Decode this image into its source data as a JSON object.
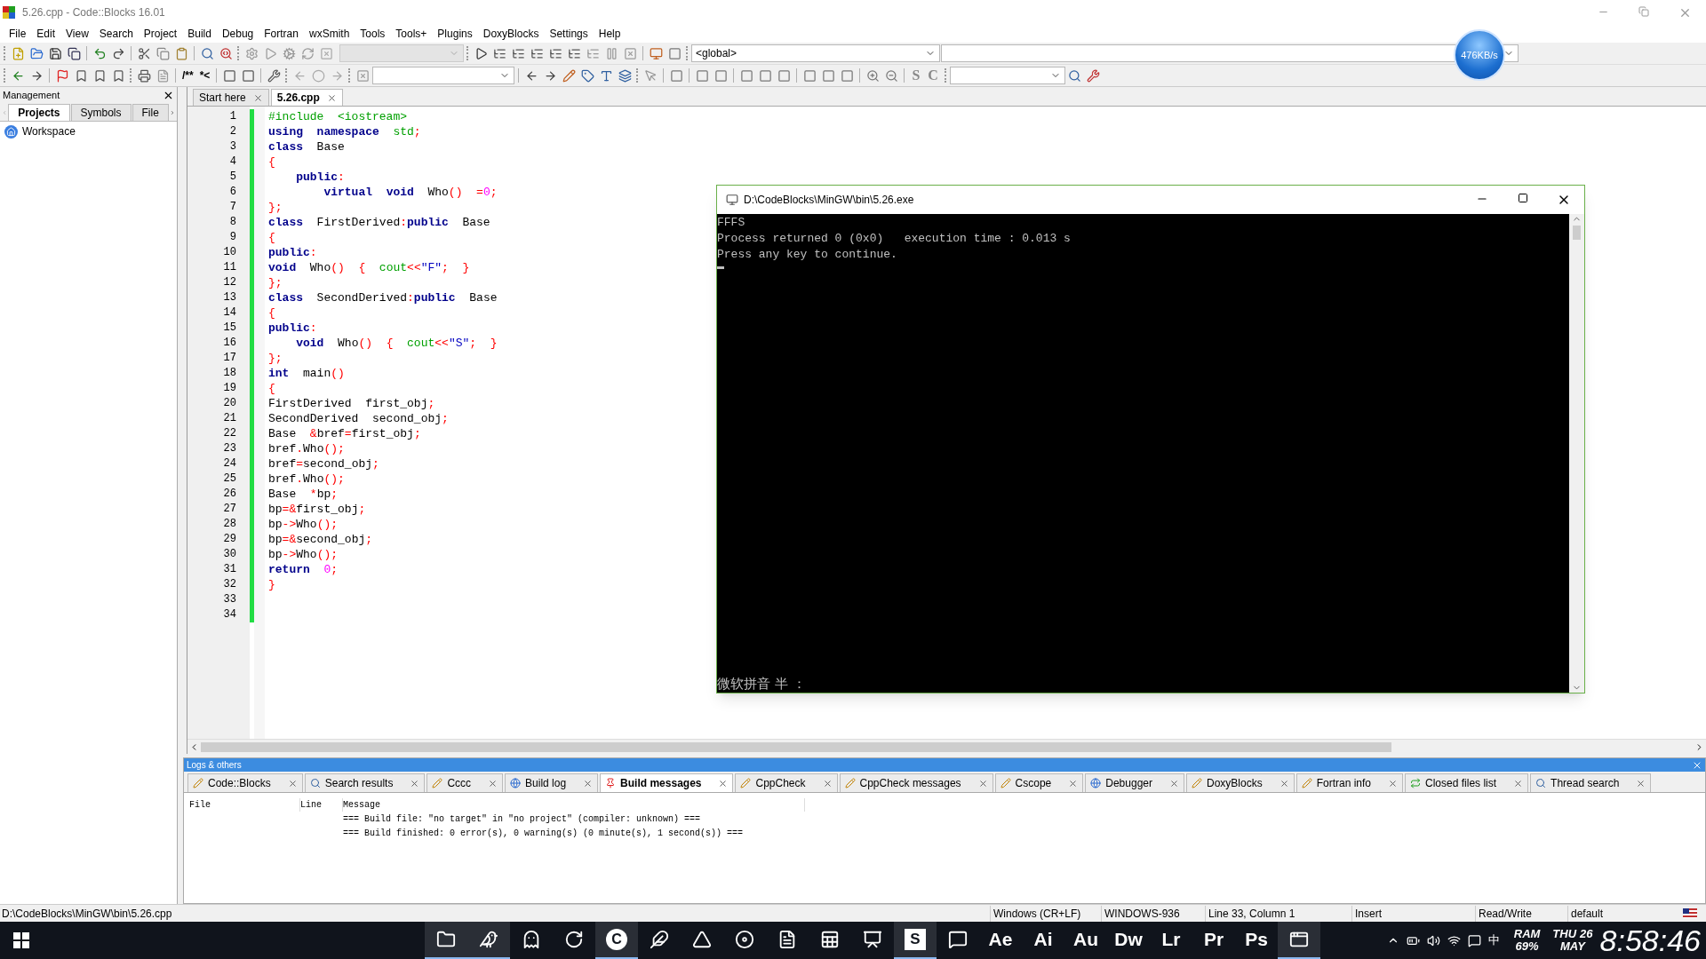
{
  "window": {
    "title": "5.26.cpp - Code::Blocks 16.01"
  },
  "menu": [
    "File",
    "Edit",
    "View",
    "Search",
    "Project",
    "Build",
    "Debug",
    "Fortran",
    "wxSmith",
    "Tools",
    "Tools+",
    "Plugins",
    "DoxyBlocks",
    "Settings",
    "Help"
  ],
  "toolbar": {
    "scope": "<global>",
    "comment_buttons": [
      "/**",
      "*<"
    ],
    "text_buttons": [
      "S",
      "C"
    ]
  },
  "net_speed": "476KB/s",
  "management": {
    "title": "Management",
    "tabs": [
      {
        "label": "Projects",
        "selected": true
      },
      {
        "label": "Symbols",
        "selected": false
      },
      {
        "label": "File",
        "selected": false
      }
    ],
    "tree": [
      {
        "label": "Workspace"
      }
    ]
  },
  "editor": {
    "tabs": [
      {
        "label": "Start here",
        "selected": false
      },
      {
        "label": "5.26.cpp",
        "selected": true
      }
    ],
    "lines": [
      {
        "number": "1",
        "tokens": [
          {
            "text": "#include  <iostream>",
            "kind": "pp"
          }
        ]
      },
      {
        "number": "2",
        "tokens": [
          {
            "text": "using",
            "kind": "kw"
          },
          {
            "text": "  namespace",
            "kind": "kw"
          },
          {
            "text": "  std",
            "kind": "lib"
          },
          {
            "text": ";",
            "kind": "op"
          }
        ]
      },
      {
        "number": "3",
        "tokens": [
          {
            "text": "class",
            "kind": "kw"
          },
          {
            "text": "  Base",
            "kind": "plain"
          }
        ]
      },
      {
        "number": "4",
        "tokens": [
          {
            "text": "{",
            "kind": "op"
          }
        ]
      },
      {
        "number": "5",
        "tokens": [
          {
            "text": "    public",
            "kind": "kw"
          },
          {
            "text": ":",
            "kind": "op"
          }
        ]
      },
      {
        "number": "6",
        "tokens": [
          {
            "text": "        virtual",
            "kind": "kw"
          },
          {
            "text": "  void",
            "kind": "kw"
          },
          {
            "text": "  Who",
            "kind": "plain"
          },
          {
            "text": "()",
            "kind": "op"
          },
          {
            "text": "  =",
            "kind": "op"
          },
          {
            "text": "0",
            "kind": "num"
          },
          {
            "text": ";",
            "kind": "op"
          }
        ]
      },
      {
        "number": "7",
        "tokens": [
          {
            "text": "};",
            "kind": "op"
          }
        ]
      },
      {
        "number": "8",
        "tokens": [
          {
            "text": "class",
            "kind": "kw"
          },
          {
            "text": "  FirstDerived",
            "kind": "plain"
          },
          {
            "text": ":",
            "kind": "op"
          },
          {
            "text": "public",
            "kind": "kw"
          },
          {
            "text": "  Base",
            "kind": "plain"
          }
        ]
      },
      {
        "number": "9",
        "tokens": [
          {
            "text": "{",
            "kind": "op"
          }
        ]
      },
      {
        "number": "10",
        "tokens": [
          {
            "text": "public",
            "kind": "kw"
          },
          {
            "text": ":",
            "kind": "op"
          }
        ]
      },
      {
        "number": "11",
        "tokens": [
          {
            "text": "void",
            "kind": "kw"
          },
          {
            "text": "  Who",
            "kind": "plain"
          },
          {
            "text": "()",
            "kind": "op"
          },
          {
            "text": "  {  ",
            "kind": "op"
          },
          {
            "text": "cout",
            "kind": "lib"
          },
          {
            "text": "<<",
            "kind": "op"
          },
          {
            "text": "\"F\"",
            "kind": "str"
          },
          {
            "text": ";  }",
            "kind": "op"
          }
        ]
      },
      {
        "number": "12",
        "tokens": [
          {
            "text": "};",
            "kind": "op"
          }
        ]
      },
      {
        "number": "13",
        "tokens": [
          {
            "text": "class",
            "kind": "kw"
          },
          {
            "text": "  SecondDerived",
            "kind": "plain"
          },
          {
            "text": ":",
            "kind": "op"
          },
          {
            "text": "public",
            "kind": "kw"
          },
          {
            "text": "  Base",
            "kind": "plain"
          }
        ]
      },
      {
        "number": "14",
        "tokens": [
          {
            "text": "{",
            "kind": "op"
          }
        ]
      },
      {
        "number": "15",
        "tokens": [
          {
            "text": "public",
            "kind": "kw"
          },
          {
            "text": ":",
            "kind": "op"
          }
        ]
      },
      {
        "number": "16",
        "tokens": [
          {
            "text": "    void",
            "kind": "kw"
          },
          {
            "text": "  Who",
            "kind": "plain"
          },
          {
            "text": "()",
            "kind": "op"
          },
          {
            "text": "  {  ",
            "kind": "op"
          },
          {
            "text": "cout",
            "kind": "lib"
          },
          {
            "text": "<<",
            "kind": "op"
          },
          {
            "text": "\"S\"",
            "kind": "str"
          },
          {
            "text": ";  }",
            "kind": "op"
          }
        ]
      },
      {
        "number": "17",
        "tokens": [
          {
            "text": "};",
            "kind": "op"
          }
        ]
      },
      {
        "number": "18",
        "tokens": [
          {
            "text": "int",
            "kind": "kw"
          },
          {
            "text": "  main",
            "kind": "plain"
          },
          {
            "text": "()",
            "kind": "op"
          }
        ]
      },
      {
        "number": "19",
        "tokens": [
          {
            "text": "{",
            "kind": "op"
          }
        ]
      },
      {
        "number": "20",
        "tokens": [
          {
            "text": "FirstDerived  first_obj",
            "kind": "plain"
          },
          {
            "text": ";",
            "kind": "op"
          }
        ]
      },
      {
        "number": "21",
        "tokens": [
          {
            "text": "SecondDerived  second_obj",
            "kind": "plain"
          },
          {
            "text": ";",
            "kind": "op"
          }
        ]
      },
      {
        "number": "22",
        "tokens": [
          {
            "text": "Base  ",
            "kind": "plain"
          },
          {
            "text": "&",
            "kind": "op"
          },
          {
            "text": "bref",
            "kind": "plain"
          },
          {
            "text": "=",
            "kind": "op"
          },
          {
            "text": "first_obj",
            "kind": "plain"
          },
          {
            "text": ";",
            "kind": "op"
          }
        ]
      },
      {
        "number": "23",
        "tokens": [
          {
            "text": "bref",
            "kind": "plain"
          },
          {
            "text": ".",
            "kind": "op"
          },
          {
            "text": "Who",
            "kind": "plain"
          },
          {
            "text": "();",
            "kind": "op"
          }
        ]
      },
      {
        "number": "24",
        "tokens": [
          {
            "text": "bref",
            "kind": "plain"
          },
          {
            "text": "=",
            "kind": "op"
          },
          {
            "text": "second_obj",
            "kind": "plain"
          },
          {
            "text": ";",
            "kind": "op"
          }
        ]
      },
      {
        "number": "25",
        "tokens": [
          {
            "text": "bref",
            "kind": "plain"
          },
          {
            "text": ".",
            "kind": "op"
          },
          {
            "text": "Who",
            "kind": "plain"
          },
          {
            "text": "();",
            "kind": "op"
          }
        ]
      },
      {
        "number": "26",
        "tokens": [
          {
            "text": "Base  ",
            "kind": "plain"
          },
          {
            "text": "*",
            "kind": "op"
          },
          {
            "text": "bp",
            "kind": "plain"
          },
          {
            "text": ";",
            "kind": "op"
          }
        ]
      },
      {
        "number": "27",
        "tokens": [
          {
            "text": "bp",
            "kind": "plain"
          },
          {
            "text": "=&",
            "kind": "op"
          },
          {
            "text": "first_obj",
            "kind": "plain"
          },
          {
            "text": ";",
            "kind": "op"
          }
        ]
      },
      {
        "number": "28",
        "tokens": [
          {
            "text": "bp",
            "kind": "plain"
          },
          {
            "text": "->",
            "kind": "op"
          },
          {
            "text": "Who",
            "kind": "plain"
          },
          {
            "text": "();",
            "kind": "op"
          }
        ]
      },
      {
        "number": "29",
        "tokens": [
          {
            "text": "bp",
            "kind": "plain"
          },
          {
            "text": "=&",
            "kind": "op"
          },
          {
            "text": "second_obj",
            "kind": "plain"
          },
          {
            "text": ";",
            "kind": "op"
          }
        ]
      },
      {
        "number": "30",
        "tokens": [
          {
            "text": "bp",
            "kind": "plain"
          },
          {
            "text": "->",
            "kind": "op"
          },
          {
            "text": "Who",
            "kind": "plain"
          },
          {
            "text": "();",
            "kind": "op"
          }
        ]
      },
      {
        "number": "31",
        "tokens": [
          {
            "text": "return",
            "kind": "kw"
          },
          {
            "text": "  0",
            "kind": "num"
          },
          {
            "text": ";",
            "kind": "op"
          }
        ]
      },
      {
        "number": "32",
        "tokens": [
          {
            "text": "}",
            "kind": "op"
          }
        ]
      },
      {
        "number": "33"
      },
      {
        "number": "34"
      }
    ]
  },
  "console": {
    "title": "D:\\CodeBlocks\\MinGW\\bin\\5.26.exe",
    "lines": [
      "FFFS",
      "Process returned 0 (0x0)   execution time : 0.013 s",
      "Press any key to continue."
    ],
    "ime_status": "微软拼音 半 ："
  },
  "logs": {
    "title": "Logs & others",
    "tabs": [
      {
        "label": "Code::Blocks",
        "selected": false
      },
      {
        "label": "Search results",
        "selected": false
      },
      {
        "label": "Cccc",
        "selected": false
      },
      {
        "label": "Build log",
        "selected": false
      },
      {
        "label": "Build messages",
        "selected": true
      },
      {
        "label": "CppCheck",
        "selected": false
      },
      {
        "label": "CppCheck messages",
        "selected": false
      },
      {
        "label": "Cscope",
        "selected": false
      },
      {
        "label": "Debugger",
        "selected": false
      },
      {
        "label": "DoxyBlocks",
        "selected": false
      },
      {
        "label": "Fortran info",
        "selected": false
      },
      {
        "label": "Closed files list",
        "selected": false
      },
      {
        "label": "Thread search",
        "selected": false
      }
    ],
    "columns": [
      "File",
      "Line",
      "Message"
    ],
    "rows": [
      {
        "message": "=== Build file: \"no target\" in \"no project\" (compiler: unknown) ==="
      },
      {
        "message": "=== Build finished: 0 error(s), 0 warning(s) (0 minute(s), 1 second(s)) ==="
      }
    ]
  },
  "status_bar": {
    "path": "D:\\CodeBlocks\\MinGW\\bin\\5.26.cpp",
    "line_endings": "Windows (CR+LF)",
    "encoding": "WINDOWS-936",
    "position": "Line 33, Column 1",
    "mode": "Insert",
    "access": "Read/Write",
    "theme": "default"
  },
  "taskbar": {
    "apps": [
      {
        "kind": "icon",
        "running": true
      },
      {
        "kind": "icon",
        "running": true
      },
      {
        "kind": "icon",
        "running": false
      },
      {
        "kind": "icon",
        "running": false
      },
      {
        "kind": "disc",
        "label": "C",
        "running": true
      },
      {
        "kind": "icon",
        "running": false
      },
      {
        "kind": "icon",
        "running": false
      },
      {
        "kind": "icon",
        "running": false
      },
      {
        "kind": "icon",
        "running": false
      },
      {
        "kind": "icon",
        "running": false
      },
      {
        "kind": "icon",
        "running": false
      },
      {
        "kind": "tile",
        "label": "S",
        "running": true
      },
      {
        "kind": "icon",
        "running": false
      },
      {
        "kind": "text",
        "label": "Ae",
        "running": false
      },
      {
        "kind": "text",
        "label": "Ai",
        "running": false
      },
      {
        "kind": "text",
        "label": "Au",
        "running": false
      },
      {
        "kind": "text",
        "label": "Dw",
        "running": false
      },
      {
        "kind": "text",
        "label": "Lr",
        "running": false
      },
      {
        "kind": "text",
        "label": "Pr",
        "running": false
      },
      {
        "kind": "text",
        "label": "Ps",
        "running": false
      },
      {
        "kind": "icon",
        "running": true
      }
    ],
    "tray": {
      "ime": "中",
      "ram_label": "RAM",
      "ram_value": "69%",
      "day": "THU",
      "date": "26",
      "month": "MAY",
      "time": "8:58:46"
    }
  }
}
